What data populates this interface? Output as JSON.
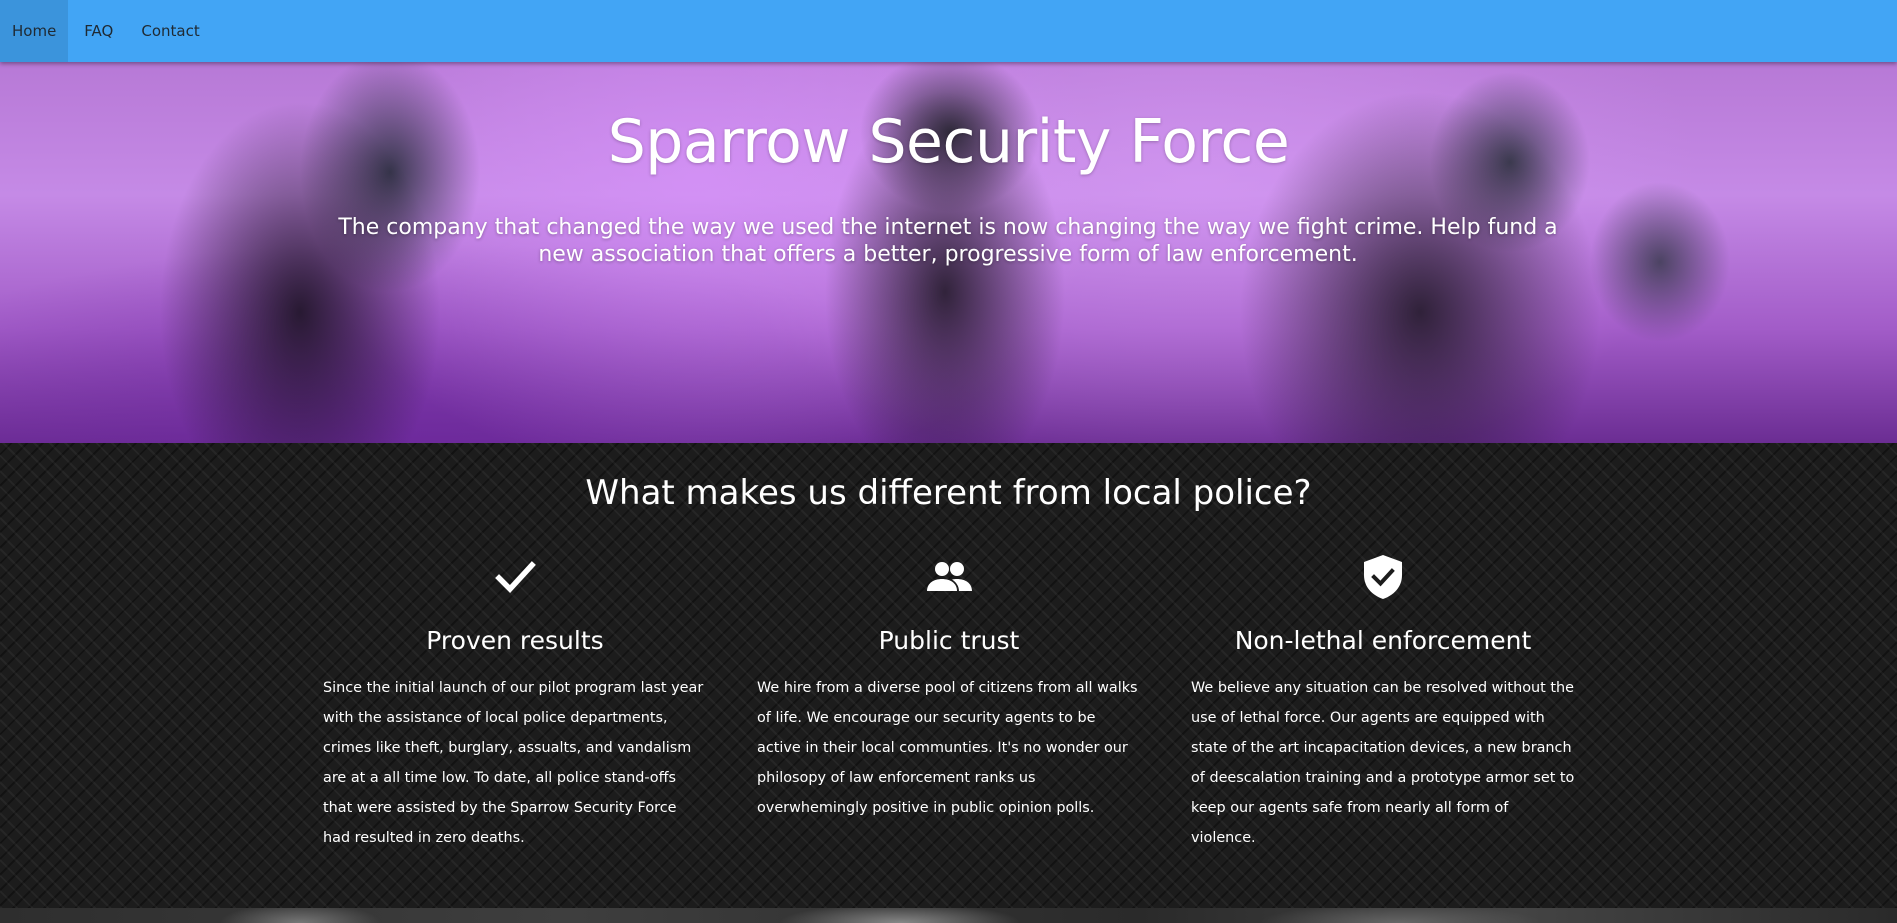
{
  "nav": {
    "items": [
      {
        "label": "Home",
        "active": true
      },
      {
        "label": "FAQ",
        "active": false
      },
      {
        "label": "Contact",
        "active": false
      }
    ]
  },
  "hero": {
    "title": "Sparrow Security Force",
    "subtitle": "The company that changed the way we used the internet is now changing the way we fight crime. Help fund a new association that offers a better, progressive form of law enforcement."
  },
  "features": {
    "title": "What makes us different from local police?",
    "columns": [
      {
        "icon": "check-icon",
        "title": "Proven results",
        "text": "Since the initial launch of our pilot program last year with the assistance of local police departments, crimes like theft, burglary, assualts, and vandalism are at a all time low. To date, all police stand-offs that were assisted by the Sparrow Security Force had resulted in zero deaths."
      },
      {
        "icon": "people-icon",
        "title": "Public trust",
        "text": "We hire from a diverse pool of citizens from all walks of life. We encourage our security agents to be active in their local communties. It's no wonder our philosopy of law enforcement ranks us overwhemingly positive in public opinion polls."
      },
      {
        "icon": "shield-check-icon",
        "title": "Non-lethal enforcement",
        "text": "We believe any situation can be resolved without the use of lethal force. Our agents are equipped with state of the art incapacitation devices, a new branch of deescalation training and a prototype armor set to keep our agents safe from nearly all form of violence."
      }
    ]
  },
  "colors": {
    "navbar": "#42a5f5",
    "nav_active": "#3b94dc",
    "features_bg": "#1c1c1c"
  }
}
